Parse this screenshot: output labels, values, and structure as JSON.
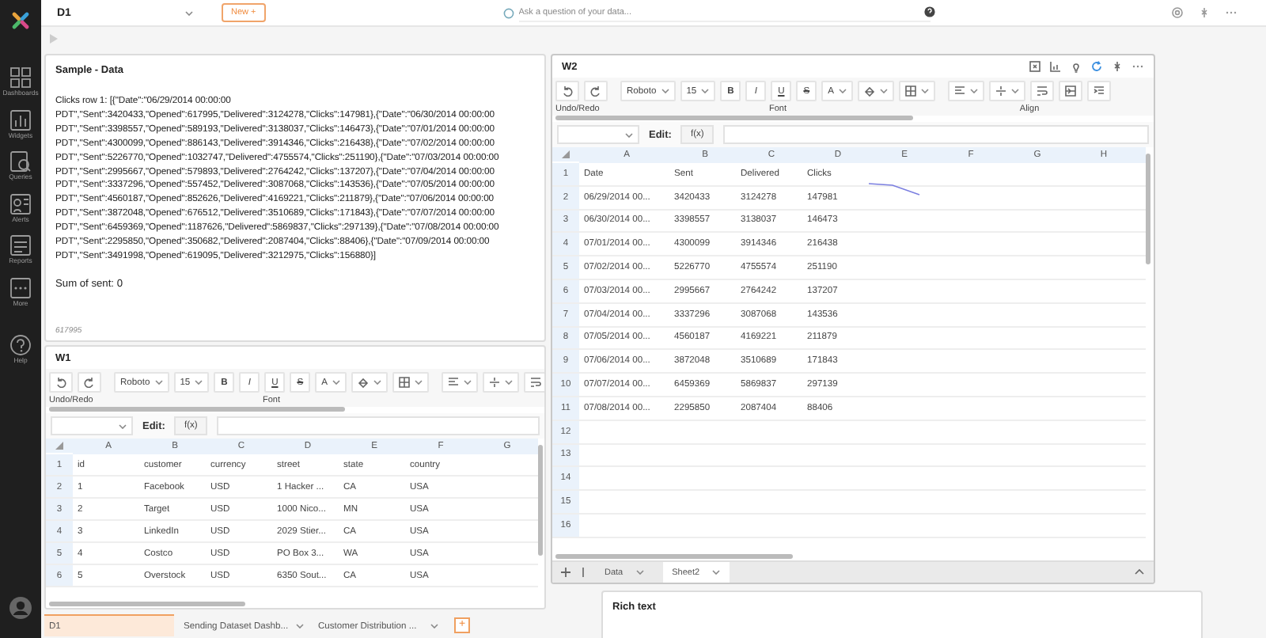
{
  "sidebar": {
    "items": [
      {
        "label": "Dashboards",
        "kind": "dashboards"
      },
      {
        "label": "Widgets",
        "kind": "widgets"
      },
      {
        "label": "Queries",
        "kind": "queries"
      },
      {
        "label": "Alerts",
        "kind": "alerts"
      },
      {
        "label": "Reports",
        "kind": "reports"
      },
      {
        "label": "More",
        "kind": "more"
      },
      {
        "label": "Help",
        "kind": "help"
      }
    ]
  },
  "topbar": {
    "dashboard_name": "D1",
    "new_button": "New +",
    "search_placeholder": "Ask a question of your data..."
  },
  "sample_panel": {
    "title": "Sample - Data",
    "text": "Clicks row 1:  [{\"Date\":\"06/29/2014 00:00:00 PDT\",\"Sent\":3420433,\"Opened\":617995,\"Delivered\":3124278,\"Clicks\":147981},{\"Date\":\"06/30/2014 00:00:00 PDT\",\"Sent\":3398557,\"Opened\":589193,\"Delivered\":3138037,\"Clicks\":146473},{\"Date\":\"07/01/2014 00:00:00 PDT\",\"Sent\":4300099,\"Opened\":886143,\"Delivered\":3914346,\"Clicks\":216438},{\"Date\":\"07/02/2014 00:00:00 PDT\",\"Sent\":5226770,\"Opened\":1032747,\"Delivered\":4755574,\"Clicks\":251190},{\"Date\":\"07/03/2014 00:00:00 PDT\",\"Sent\":2995667,\"Opened\":579893,\"Delivered\":2764242,\"Clicks\":137207},{\"Date\":\"07/04/2014 00:00:00 PDT\",\"Sent\":3337296,\"Opened\":557452,\"Delivered\":3087068,\"Clicks\":143536},{\"Date\":\"07/05/2014 00:00:00 PDT\",\"Sent\":4560187,\"Opened\":852626,\"Delivered\":4169221,\"Clicks\":211879},{\"Date\":\"07/06/2014 00:00:00 PDT\",\"Sent\":3872048,\"Opened\":676512,\"Delivered\":3510689,\"Clicks\":171843},{\"Date\":\"07/07/2014 00:00:00 PDT\",\"Sent\":6459369,\"Opened\":1187626,\"Delivered\":5869837,\"Clicks\":297139},{\"Date\":\"07/08/2014 00:00:00 PDT\",\"Sent\":2295850,\"Opened\":350682,\"Delivered\":2087404,\"Clicks\":88406},{\"Date\":\"07/09/2014 00:00:00 PDT\",\"Sent\":3491998,\"Opened\":619095,\"Delivered\":3212975,\"Clicks\":156880}]",
    "sum_text": "Sum of sent: 0",
    "footer": "617995"
  },
  "w1": {
    "title": "W1",
    "font": "Roboto",
    "font_size": "15",
    "format_buttons": [
      "B",
      "I",
      "U",
      "S"
    ],
    "font_color_button": "A",
    "group_labels": [
      "Undo/Redo",
      "Font"
    ],
    "edit_label": "Edit:",
    "fx_button": "f(x)",
    "columns": [
      "A",
      "B",
      "C",
      "D",
      "E",
      "F",
      "G"
    ],
    "rows": [
      {
        "number": "1",
        "cells": [
          "id",
          "customer",
          "currency",
          "street",
          "state",
          "country",
          ""
        ]
      },
      {
        "number": "2",
        "cells": [
          "1",
          "Facebook",
          "USD",
          "1 Hacker ...",
          "CA",
          "USA",
          ""
        ]
      },
      {
        "number": "3",
        "cells": [
          "2",
          "Target",
          "USD",
          "1000 Nico...",
          "MN",
          "USA",
          ""
        ]
      },
      {
        "number": "4",
        "cells": [
          "3",
          "LinkedIn",
          "USD",
          "2029 Stier...",
          "CA",
          "USA",
          ""
        ]
      },
      {
        "number": "5",
        "cells": [
          "4",
          "Costco",
          "USD",
          "PO Box 3...",
          "WA",
          "USA",
          ""
        ]
      },
      {
        "number": "6",
        "cells": [
          "5",
          "Overstock",
          "USD",
          "6350 Sout...",
          "CA",
          "USA",
          ""
        ]
      }
    ]
  },
  "w2": {
    "title": "W2",
    "font": "Roboto",
    "font_size": "15",
    "format_buttons": [
      "B",
      "I",
      "U",
      "S"
    ],
    "font_color_button": "A",
    "group_labels": [
      "Undo/Redo",
      "Font",
      "Align"
    ],
    "edit_label": "Edit:",
    "fx_button": "f(x)",
    "columns": [
      "A",
      "B",
      "C",
      "D",
      "E",
      "F",
      "G",
      "H"
    ],
    "rows": [
      {
        "number": "1",
        "cells": [
          "Date",
          "Sent",
          "Delivered",
          "Clicks"
        ]
      },
      {
        "number": "2",
        "cells": [
          "06/29/2014 00...",
          "3420433",
          "3124278",
          "147981"
        ]
      },
      {
        "number": "3",
        "cells": [
          "06/30/2014 00...",
          "3398557",
          "3138037",
          "146473"
        ]
      },
      {
        "number": "4",
        "cells": [
          "07/01/2014 00...",
          "4300099",
          "3914346",
          "216438"
        ]
      },
      {
        "number": "5",
        "cells": [
          "07/02/2014 00...",
          "5226770",
          "4755574",
          "251190"
        ]
      },
      {
        "number": "6",
        "cells": [
          "07/03/2014 00...",
          "2995667",
          "2764242",
          "137207"
        ]
      },
      {
        "number": "7",
        "cells": [
          "07/04/2014 00...",
          "3337296",
          "3087068",
          "143536"
        ]
      },
      {
        "number": "8",
        "cells": [
          "07/05/2014 00...",
          "4560187",
          "4169221",
          "211879"
        ]
      },
      {
        "number": "9",
        "cells": [
          "07/06/2014 00...",
          "3872048",
          "3510689",
          "171843"
        ]
      },
      {
        "number": "10",
        "cells": [
          "07/07/2014 00...",
          "6459369",
          "5869837",
          "297139"
        ]
      },
      {
        "number": "11",
        "cells": [
          "07/08/2014 00...",
          "2295850",
          "2087404",
          "88406"
        ]
      },
      {
        "number": "12",
        "cells": []
      },
      {
        "number": "13",
        "cells": []
      },
      {
        "number": "14",
        "cells": []
      },
      {
        "number": "15",
        "cells": []
      },
      {
        "number": "16",
        "cells": []
      }
    ],
    "sheet_tabs": [
      {
        "label": "Data",
        "selected": false
      },
      {
        "label": "Sheet2",
        "selected": true
      }
    ]
  },
  "rich_text_panel": {
    "title": "Rich text"
  },
  "dashboard_tabs": [
    {
      "label": "D1",
      "selected": true
    },
    {
      "label": "Sending Dataset Dashb...",
      "selected": false
    },
    {
      "label": "Customer Distribution ...",
      "selected": false
    }
  ],
  "add_tab_button": "+"
}
